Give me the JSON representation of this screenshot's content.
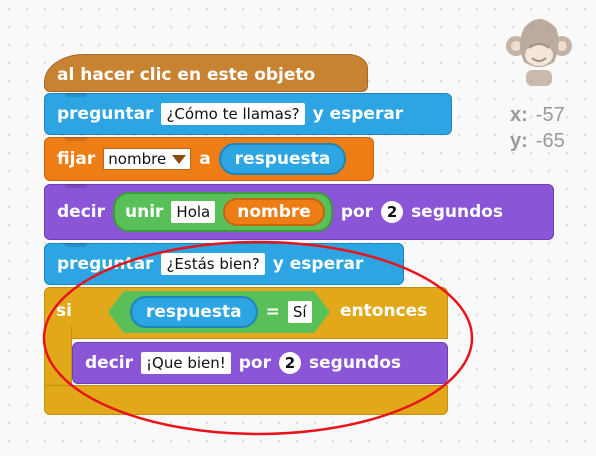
{
  "hat": {
    "label": "al hacer clic en este objeto"
  },
  "ask1": {
    "label": "preguntar",
    "question": "¿Cómo te llamas?",
    "suffix": "y esperar"
  },
  "set": {
    "label": "fijar",
    "variable": "nombre",
    "to": "a",
    "value": "respuesta"
  },
  "say1": {
    "label": "decir",
    "join": "unir",
    "join_text": "Hola",
    "join_var": "nombre",
    "for": "por",
    "secs": "2",
    "unit": "segundos"
  },
  "ask2": {
    "label": "preguntar",
    "question": "¿Estás bien?",
    "suffix": "y esperar"
  },
  "if": {
    "label": "si",
    "left": "respuesta",
    "op": "=",
    "right": "Sí",
    "then": "entonces"
  },
  "say2": {
    "label": "decir",
    "text": "¡Que bien!",
    "for": "por",
    "secs": "2",
    "unit": "segundos"
  },
  "sprite": {
    "x_label": "x:",
    "x_value": "-57",
    "y_label": "y:",
    "y_value": "-65"
  },
  "colors": {
    "events": "#c88332",
    "sensing": "#2ca5e2",
    "data": "#ee7d16",
    "looks": "#8a55d7",
    "operators": "#59c059",
    "control": "#e1a91a",
    "highlight": "#e8141b"
  },
  "icons": {
    "sprite": "monkey-sprite-icon"
  }
}
